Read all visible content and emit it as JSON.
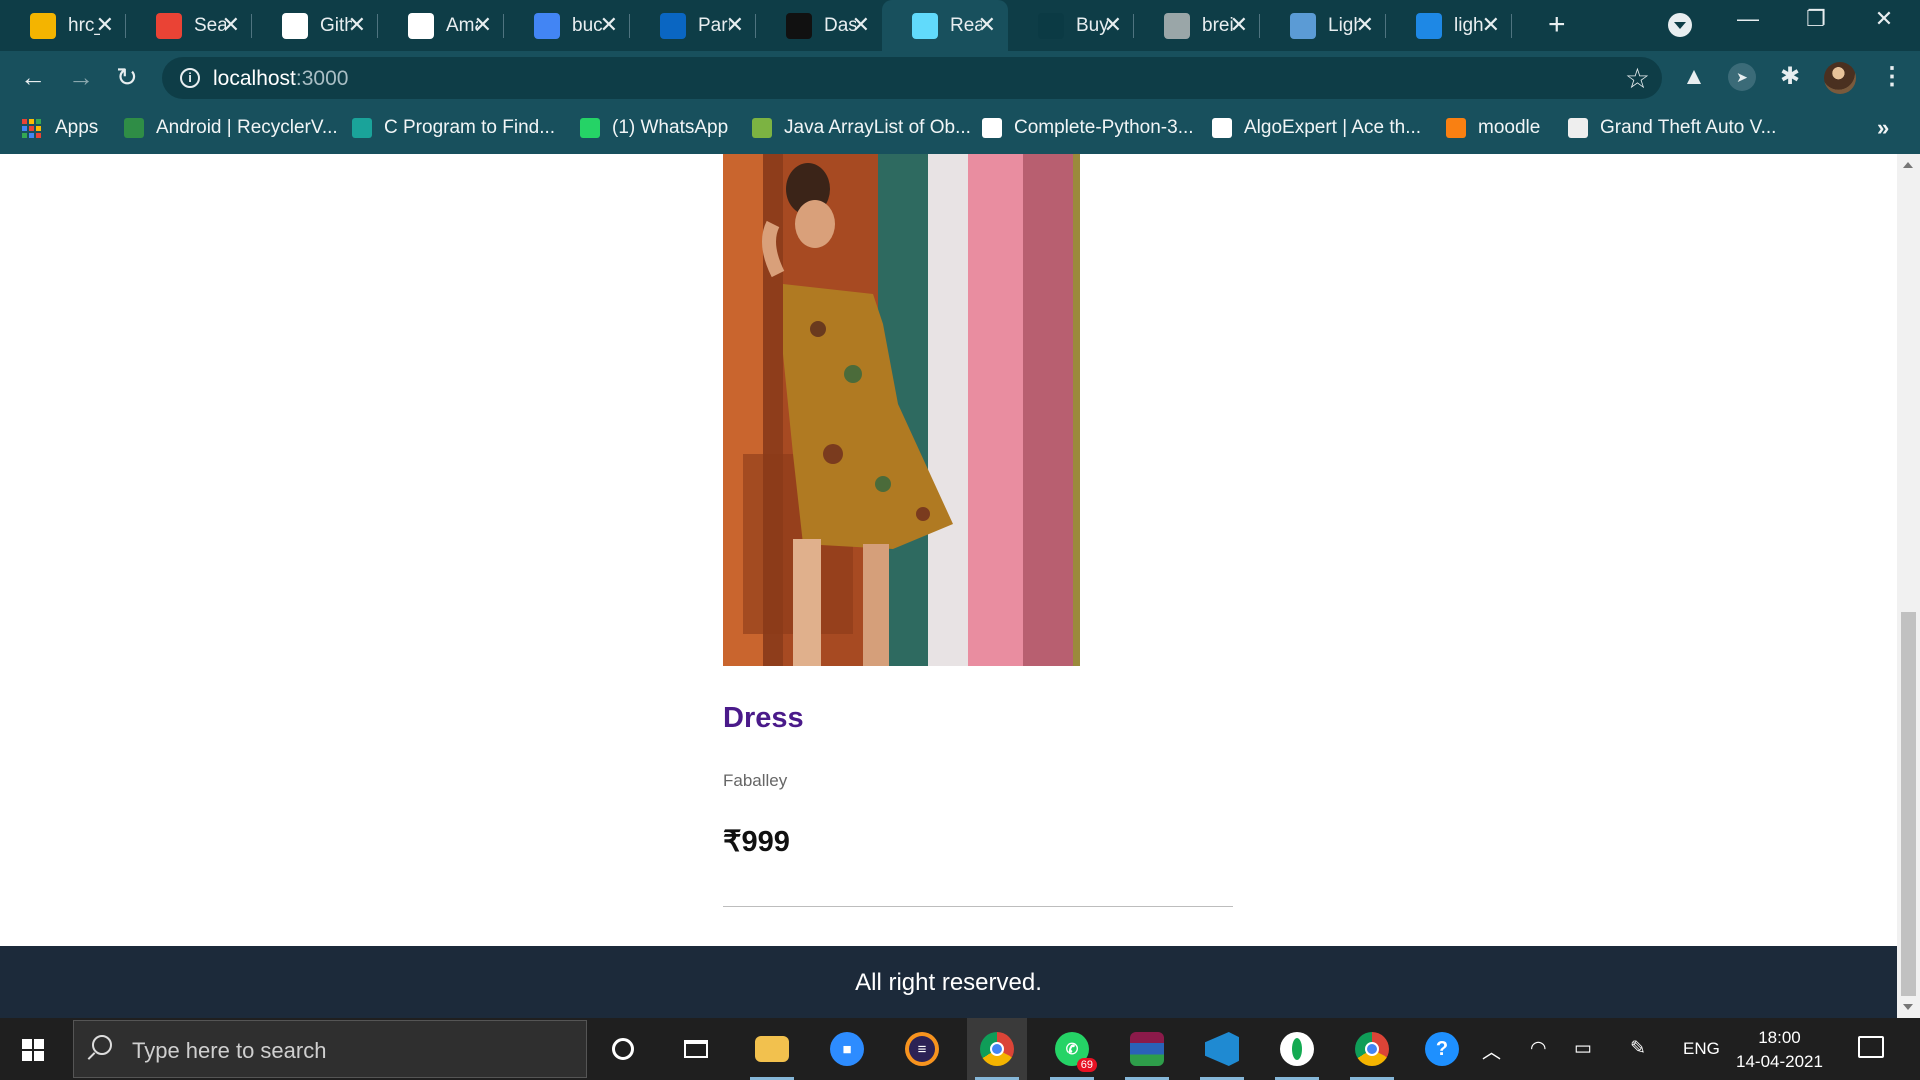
{
  "browser": {
    "tabs": [
      {
        "title": "hrc_",
        "icon": "google-drive-icon",
        "color": "#f4b400"
      },
      {
        "title": "Sear",
        "icon": "gmail-icon",
        "color": "#ea4335"
      },
      {
        "title": "Gith",
        "icon": "github-icon",
        "color": "#ffffff"
      },
      {
        "title": "Ama",
        "icon": "amazon-icon",
        "color": "#ffffff"
      },
      {
        "title": "buc",
        "icon": "google-icon",
        "color": "#4285f4"
      },
      {
        "title": "Parı",
        "icon": "linkedin-icon",
        "color": "#0a66c2"
      },
      {
        "title": "Das",
        "icon": "dashboard-icon",
        "color": "#111111"
      },
      {
        "title": "Rea",
        "icon": "react-icon",
        "color": "#61dafb"
      },
      {
        "title": "Buy",
        "icon": "buy-icon",
        "color": "#0b3a44"
      },
      {
        "title": "brei",
        "icon": "globe-icon",
        "color": "#9aa6a8"
      },
      {
        "title": "Ligh",
        "icon": "colorz-icon",
        "color": "#5b9bd5"
      },
      {
        "title": "ligh",
        "icon": "c-logo-icon",
        "color": "#1e88e5"
      }
    ],
    "active_tab_index": 7,
    "url_host": "localhost",
    "url_port": ":3000",
    "bookmarks": [
      {
        "label": "Apps",
        "icon": "apps-grid-icon"
      },
      {
        "label": "Android | RecyclerV...",
        "icon": "geeks-icon",
        "color": "#2f8d46"
      },
      {
        "label": "C Program to Find...",
        "icon": "site-icon",
        "color": "#1aa39a"
      },
      {
        "label": "(1) WhatsApp",
        "icon": "whatsapp-icon",
        "color": "#25d366"
      },
      {
        "label": "Java ArrayList of Ob...",
        "icon": "beginnersbook-icon",
        "color": "#7cb342"
      },
      {
        "label": "Complete-Python-3...",
        "icon": "github-icon",
        "color": "#ffffff"
      },
      {
        "label": "AlgoExpert | Ace th...",
        "icon": "algoexpert-icon",
        "color": "#ffffff"
      },
      {
        "label": "moodle",
        "icon": "moodle-icon",
        "color": "#f98012"
      },
      {
        "label": "Grand Theft Auto V...",
        "icon": "epic-games-icon",
        "color": "#eeeeee"
      }
    ],
    "more_bookmarks": "»"
  },
  "page": {
    "product": {
      "name": "Dress",
      "brand": "Faballey",
      "price": "₹999"
    },
    "footer_text": "All right reserved."
  },
  "taskbar": {
    "search_placeholder": "Type here to search",
    "whatsapp_badge": "69",
    "language": "ENG",
    "time": "18:00",
    "date": "14-04-2021"
  },
  "colors": {
    "chrome_frame": "#0e3d47",
    "chrome_toolbar": "#18505d",
    "product_name": "#4a1a8a",
    "footer_bg": "#1c2a3a"
  }
}
